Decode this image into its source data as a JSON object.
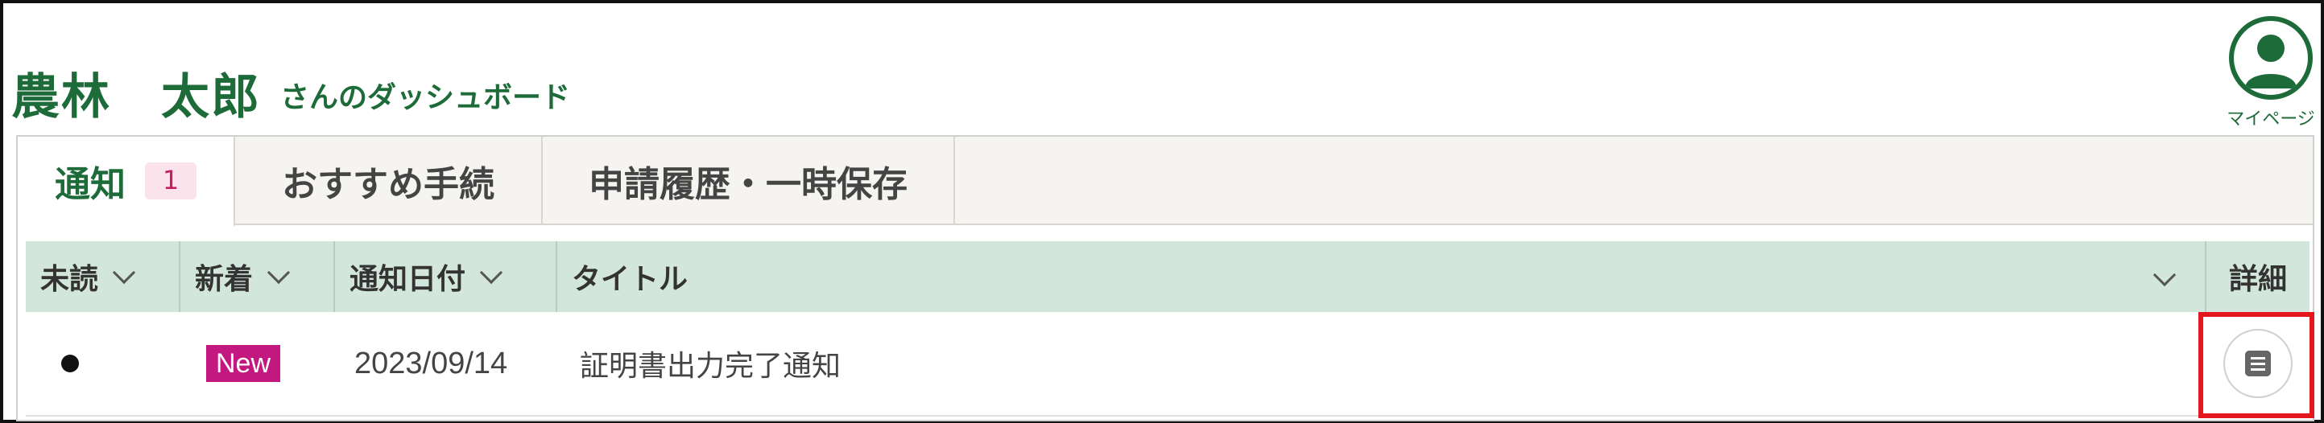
{
  "header": {
    "user_name": "農林　太郎",
    "dashboard_suffix": "さんのダッシュボード",
    "mypage_label": "マイページ"
  },
  "tabs": [
    {
      "label": "通知",
      "badge": "1",
      "active": true
    },
    {
      "label": "おすすめ手続",
      "active": false
    },
    {
      "label": "申請履歴・一時保存",
      "active": false
    }
  ],
  "table": {
    "columns": [
      "未読",
      "新着",
      "通知日付",
      "タイトル",
      "詳細"
    ],
    "rows": [
      {
        "unread": true,
        "new_label": "New",
        "date": "2023/09/14",
        "title": "証明書出力完了通知",
        "detail_icon": "document-icon"
      }
    ]
  },
  "colors": {
    "brand_green": "#1e6b3a",
    "header_bg": "#d3e6dc",
    "new_badge": "#c2187f",
    "highlight_red": "#e3171d"
  },
  "icons": {
    "mypage": "user-avatar-icon",
    "sort": "chevron-down-icon",
    "detail": "document-icon"
  }
}
